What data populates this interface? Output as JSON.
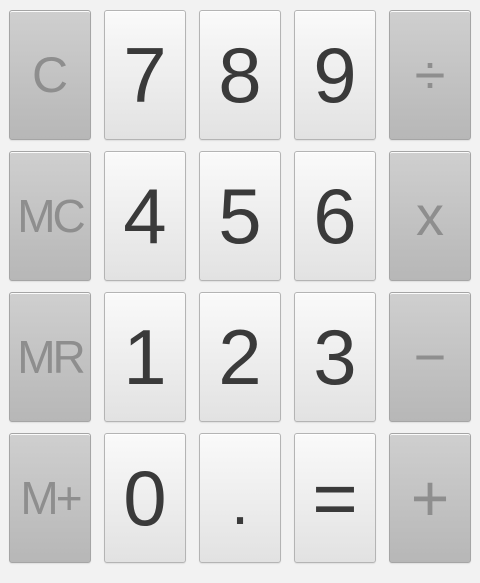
{
  "keypad": {
    "row1": {
      "clear": "C",
      "seven": "7",
      "eight": "8",
      "nine": "9",
      "divide": "÷"
    },
    "row2": {
      "memory_clear": "MC",
      "four": "4",
      "five": "5",
      "six": "6",
      "multiply": "x"
    },
    "row3": {
      "memory_recall": "MR",
      "one": "1",
      "two": "2",
      "three": "3",
      "subtract": "−"
    },
    "row4": {
      "memory_add": "M+",
      "zero": "0",
      "decimal": ".",
      "equals": "=",
      "add": "+"
    }
  },
  "colors": {
    "digit_key": "#efefef",
    "function_key": "#c3c3c3",
    "digit_text": "#3a3a3a",
    "function_text": "#8e8e8e"
  }
}
